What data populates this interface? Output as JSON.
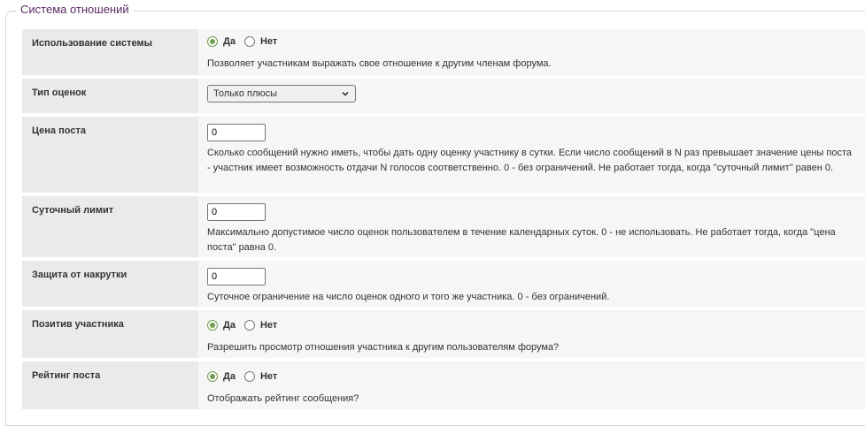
{
  "fieldset": {
    "legend": "Система отношений"
  },
  "rows": {
    "use_system": {
      "label": "Использование системы",
      "yes": "Да",
      "no": "Нет",
      "selected": "yes",
      "desc": "Позволяет участникам выражать свое отношение к другим членам форума."
    },
    "rating_type": {
      "label": "Тип оценок",
      "value": "Только плюсы"
    },
    "post_price": {
      "label": "Цена поста",
      "value": "0",
      "desc": "Сколько сообщений нужно иметь, чтобы дать одну оценку участнику в сутки. Если число сообщений в N раз превышает значение цены поста - участник имеет возможность отдачи N голосов соответственно. 0 - без ограничений. Не работает тогда, когда \"суточный лимит\" равен 0."
    },
    "daily_limit": {
      "label": "Суточный лимит",
      "value": "0",
      "desc": "Максимально допустимое число оценок пользователем в течение календарных суток. 0 - не использовать. Не работает тогда, когда \"цена поста\" равна 0."
    },
    "anti_cheat": {
      "label": "Защита от накрутки",
      "value": "0",
      "desc": "Суточное ограничение на число оценок одного и того же участника. 0 - без ограничений."
    },
    "user_positive": {
      "label": "Позитив участника",
      "yes": "Да",
      "no": "Нет",
      "selected": "yes",
      "desc": "Разрешить просмотр отношения участника к другим пользователям форума?"
    },
    "post_rating": {
      "label": "Рейтинг поста",
      "yes": "Да",
      "no": "Нет",
      "selected": "yes",
      "desc": "Отображать рейтинг сообщения?"
    }
  },
  "colors": {
    "accent": "#6f9e4f",
    "legend": "#5b2a66",
    "label_bg": "#e9ebe8",
    "control_bg": "#f6f6f6"
  }
}
